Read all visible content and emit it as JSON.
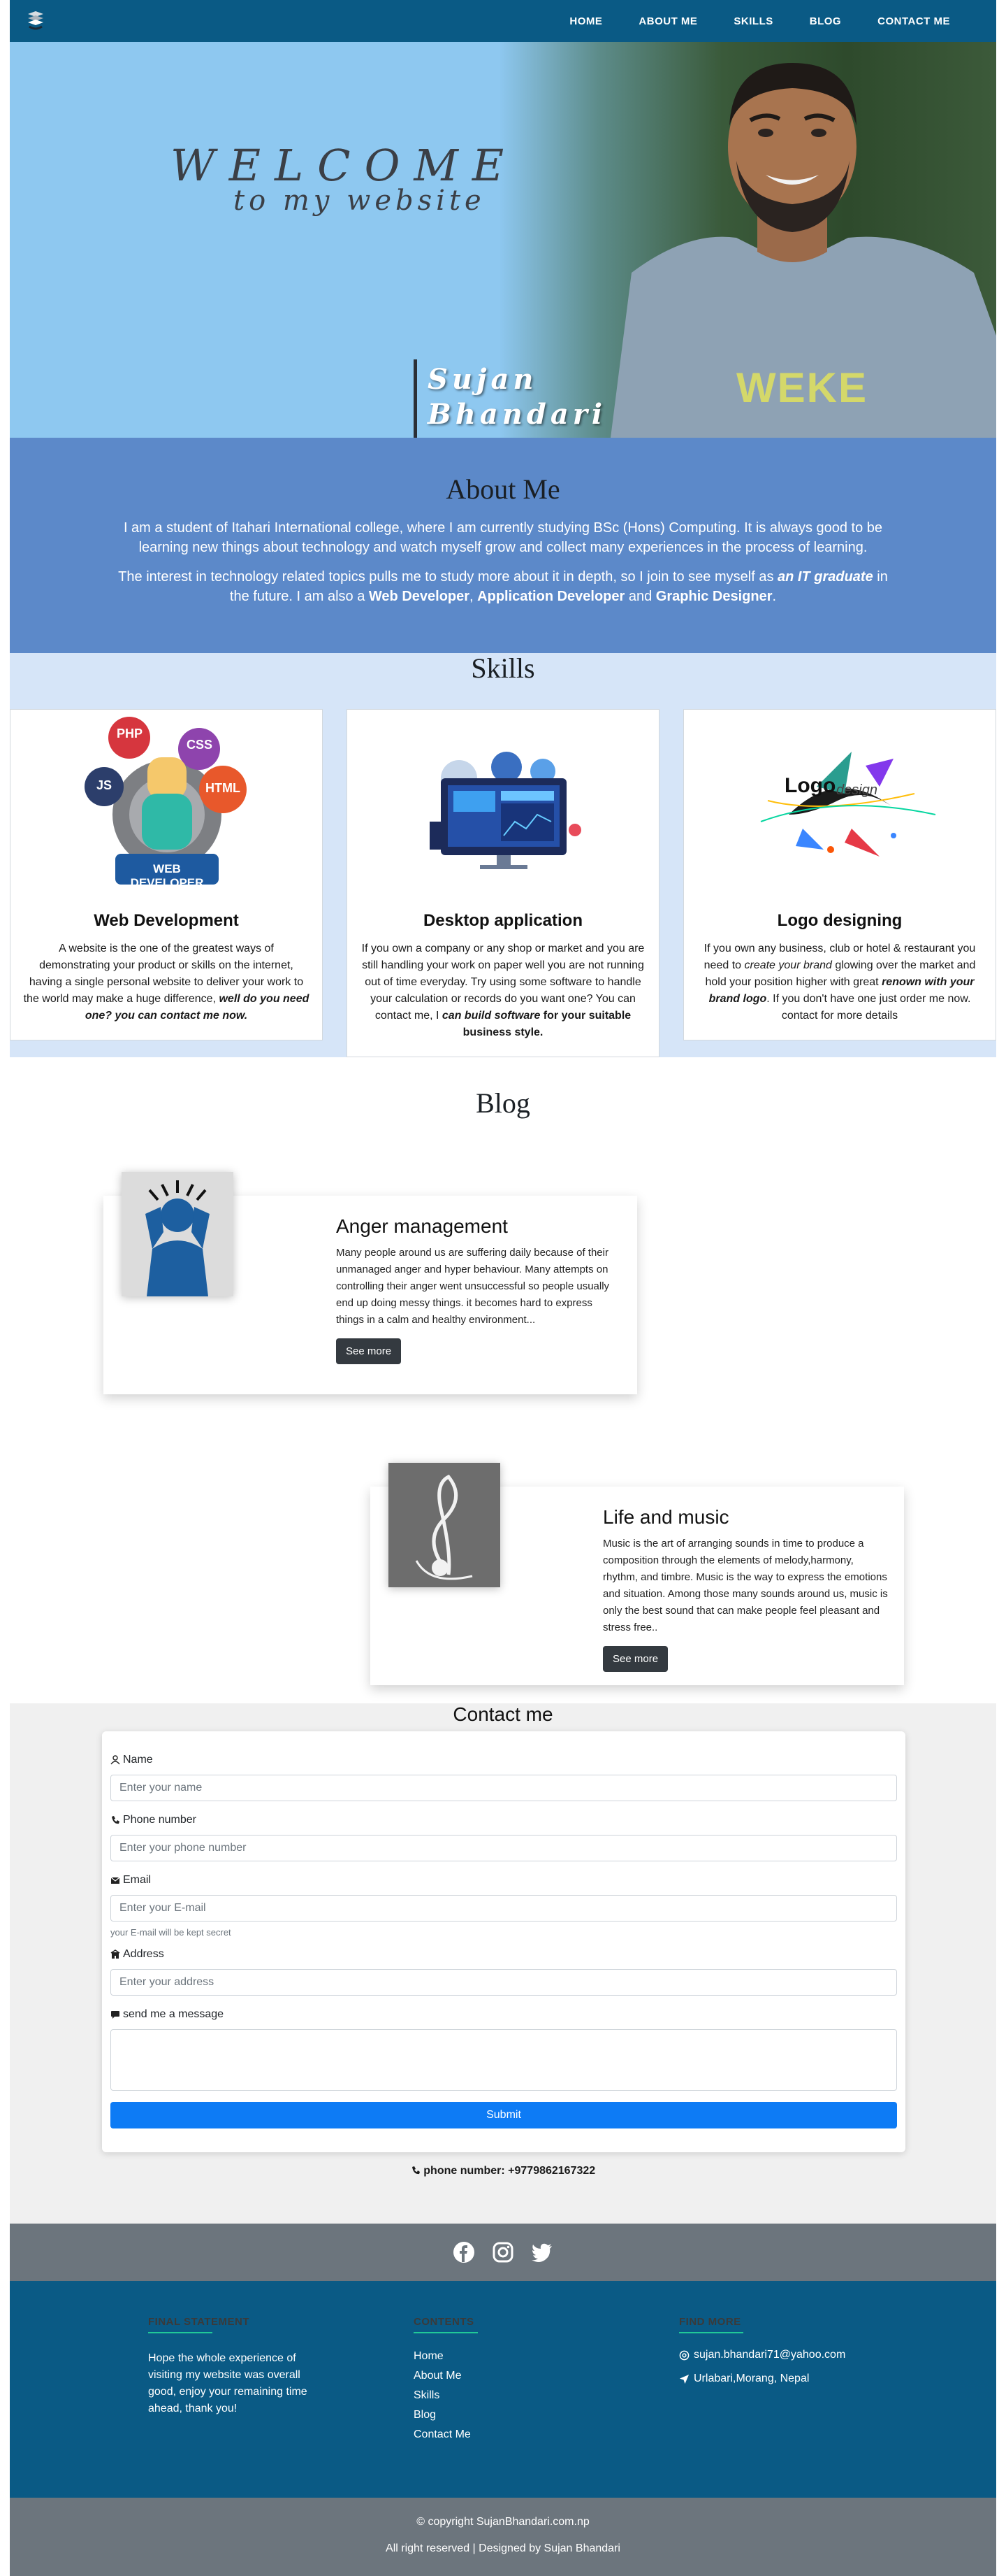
{
  "nav": {
    "links": [
      "HOME",
      "ABOUT ME",
      "SKILLS",
      "BLOG",
      "CONTACT ME"
    ]
  },
  "hero": {
    "welcome": "WELCOME",
    "tagline": "to my website",
    "name_first": "Sujan",
    "name_last": "Bhandari",
    "shirt_text": "WEKE"
  },
  "about": {
    "title": "About Me",
    "para1": "I am a student of Itahari International college, where I am currently studying BSc (Hons) Computing. It is always good to be learning new things about technology and watch myself grow and collect many experiences in the process of learning.",
    "para2_prefix": "The interest in technology related topics pulls me to study more about it in depth, so I join to see myself as ",
    "para2_em": "an IT graduate",
    "para2_mid": " in the future. I am also a ",
    "para2_role1": "Web Developer",
    "para2_sep1": ", ",
    "para2_role2": "Application Developer",
    "para2_sep2": " and ",
    "para2_role3": "Graphic Designer",
    "para2_end": "."
  },
  "skills": {
    "title": "Skills",
    "cards": [
      {
        "title": "Web Development",
        "text": "A website is the one of the greatest ways of demonstrating your product or skills on the internet, having a single personal website to deliver your work to the world may make a huge difference, ",
        "emph": "well do you need one? you can contact me now.",
        "badges": [
          "PHP",
          "CSS",
          "JS",
          "HTML"
        ],
        "banner": "WEB DEVELOPER"
      },
      {
        "title": "Desktop application",
        "text": "If you own a company or any shop or market and you are still handling your work on paper well you are not running out of time everyday. Try using some software to handle your calculation or records do you want one? You can contact me, I ",
        "emph": "can build software",
        "text_after": " for your suitable business style."
      },
      {
        "title": "Logo designing",
        "text_a": "If you own any business, club or hotel & restaurant you need to ",
        "em_a": "create your brand",
        "text_b": " glowing over the market and hold your position higher with great ",
        "emph": "renown with your brand logo",
        "text_c": ". If you don't have one just order me now. contact for more details",
        "logo_word": "Logo",
        "logo_sub": "design"
      }
    ]
  },
  "blog": {
    "title": "Blog",
    "posts": [
      {
        "title": "Anger management",
        "text": "Many people around us are suffering daily because of their unmanaged anger and hyper behaviour. Many attempts on controlling their anger went unsuccessful so people usually end up doing messy things. it becomes hard to express things in a calm and healthy environment...",
        "button": "See more"
      },
      {
        "title": "Life and music",
        "text": "Music is the art of arranging sounds in time to produce a composition through the elements of melody,harmony, rhythm, and timbre. Music is the way to express the emotions and situation. Among those many sounds around us, music is only the best sound that can make people feel pleasant and stress free..",
        "button": "See more"
      }
    ]
  },
  "contact": {
    "title": "Contact me",
    "fields": {
      "name_label": "Name",
      "name_placeholder": "Enter your name",
      "phone_label": "Phone number",
      "phone_placeholder": "Enter your phone number",
      "email_label": "Email",
      "email_placeholder": "Enter your E-mail",
      "email_help": "your E-mail will be kept secret",
      "address_label": "Address",
      "address_placeholder": "Enter your address",
      "message_label": "send me a message"
    },
    "submit": "Submit",
    "phone_line": "phone number: +9779862167322"
  },
  "social": {
    "icons": [
      "facebook-icon",
      "instagram-icon",
      "twitter-icon"
    ]
  },
  "footer": {
    "col1_title": "FINAL STATEMENT",
    "col1_text": "Hope the whole experience of visiting my website was overall good, enjoy your remaining time ahead, thank you!",
    "col2_title": "CONTENTS",
    "col2_links": [
      "Home",
      "About Me",
      "Skills",
      "Blog",
      "Contact Me"
    ],
    "col3_title": "FIND MORE",
    "email": "sujan.bhandari71@yahoo.com",
    "location": "Urlabari,Morang, Nepal"
  },
  "copyright": {
    "line1": "© copyright SujanBhandari.com.np",
    "line2": "All right reserved | Designed by Sujan Bhandari"
  },
  "colors": {
    "nav_bg": "#0a5a85",
    "about_bg": "#5c89c9",
    "skills_bg": "#d6e5f8",
    "submit_bg": "#0d7bf5",
    "footer_accent": "#20c997"
  }
}
